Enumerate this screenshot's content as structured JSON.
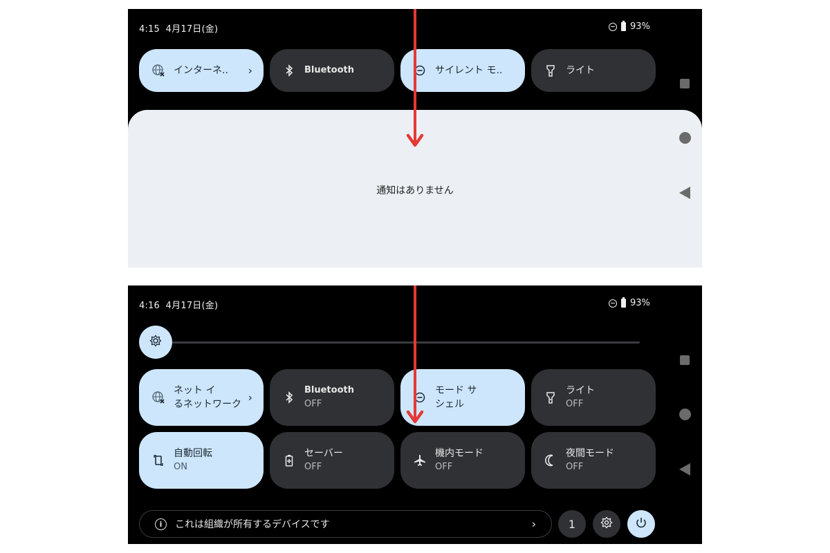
{
  "screen1": {
    "time": "4:15",
    "date": "4月17日(金)",
    "battery": "93%",
    "tiles": [
      {
        "label": "インターネ..",
        "state": "on"
      },
      {
        "label": "Bluetooth",
        "state": "off"
      },
      {
        "label": "サイレント モ..",
        "state": "on"
      },
      {
        "label": "ライト",
        "state": "off"
      }
    ],
    "notification_empty": "通知はありません"
  },
  "screen2": {
    "time": "4:16",
    "date": "4月17日(金)",
    "battery": "93%",
    "brightness_level": 0,
    "tiles": [
      {
        "label": "ネット イ",
        "sub": "るネットワーク",
        "state": "on"
      },
      {
        "label": "Bluetooth",
        "sub": "OFF",
        "state": "off"
      },
      {
        "label": "モード サ",
        "sub": "シェル",
        "state": "on"
      },
      {
        "label": "ライト",
        "sub": "OFF",
        "state": "off"
      },
      {
        "label": "自動回転",
        "sub": "ON",
        "state": "on"
      },
      {
        "label": "セーバー",
        "sub": "OFF",
        "state": "off"
      },
      {
        "label": "機内モード",
        "sub": "OFF",
        "state": "off"
      },
      {
        "label": "夜間モード",
        "sub": "OFF",
        "state": "off"
      }
    ],
    "footer_text": "これは組織が所有するデバイスです",
    "notification_count": "1"
  },
  "colors": {
    "tile_on": "#cde6fb",
    "tile_off": "#2f3135",
    "arrow": "#e53935",
    "panel": "#ecf0f4"
  }
}
